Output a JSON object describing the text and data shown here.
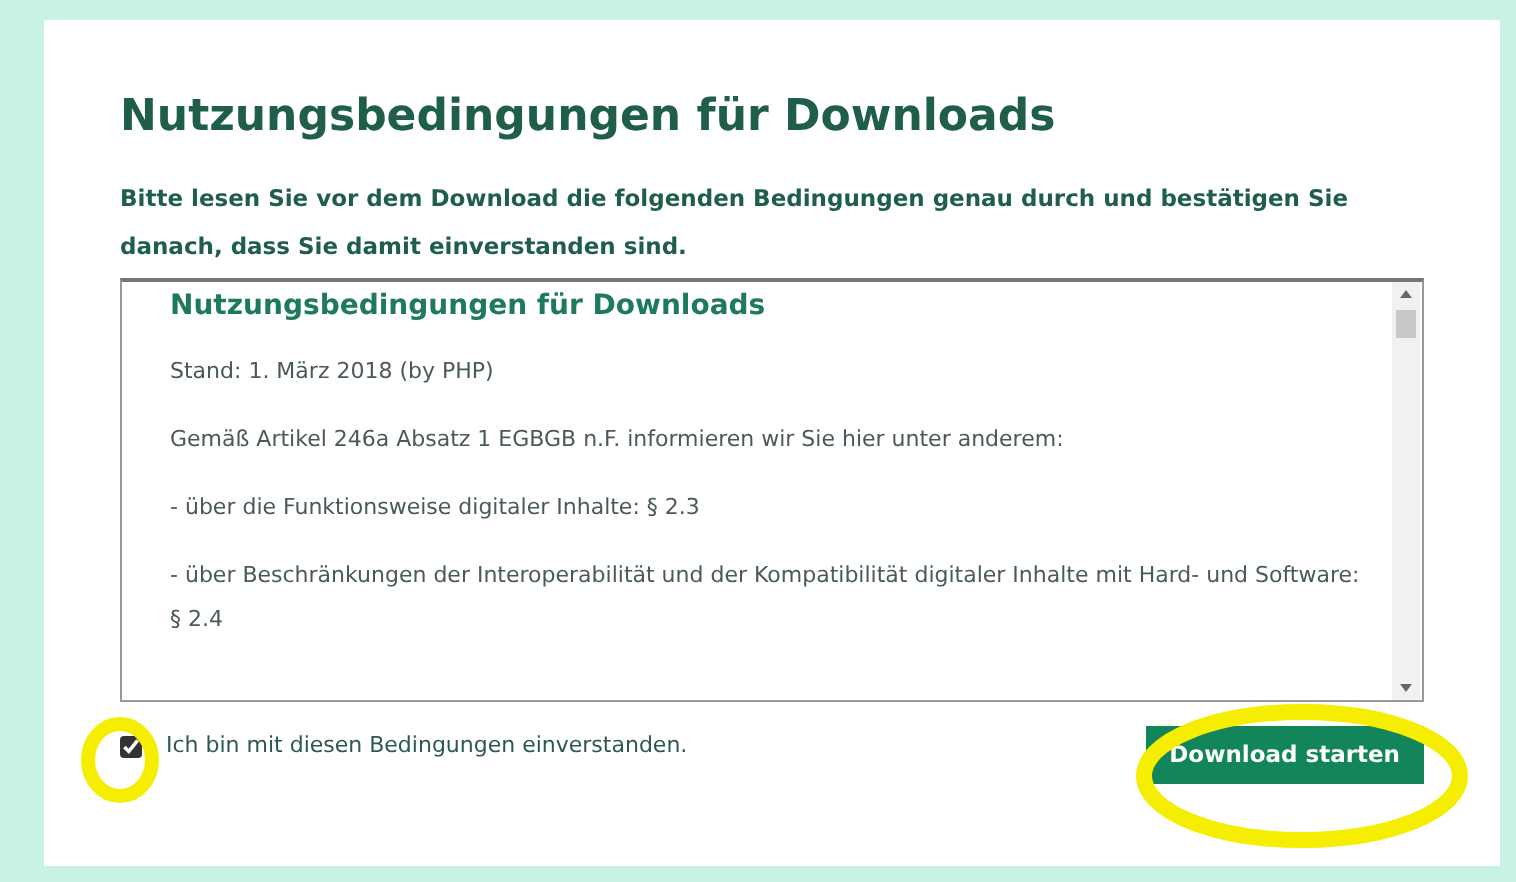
{
  "title": "Nutzungsbedingungen für Downloads",
  "intro": "Bitte lesen Sie vor dem Download die folgenden Bedingungen genau durch und bestätigen Sie danach, dass Sie damit einverstanden sind.",
  "terms_box": {
    "heading": "Nutzungsbedingungen für Downloads",
    "paragraphs": [
      "Stand: 1. März 2018 (by PHP)",
      "Gemäß Artikel 246a Absatz 1 EGBGB n.F. informieren wir Sie hier unter anderem:",
      "- über die Funktionsweise digitaler Inhalte: § 2.3",
      "- über Beschränkungen der Interoperabilität und der Kompatibilität digitaler Inhalte mit Hard- und Software: § 2.4"
    ]
  },
  "consent": {
    "label": "Ich bin mit diesen Bedingungen einverstanden.",
    "checked": true
  },
  "button": "Download starten"
}
